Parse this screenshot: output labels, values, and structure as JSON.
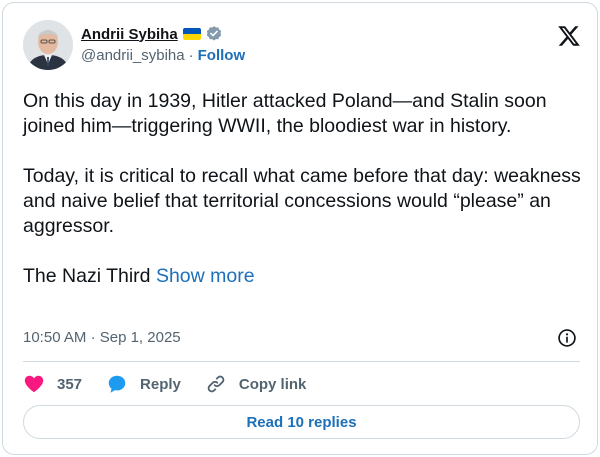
{
  "author": {
    "name": "Andrii Sybiha",
    "handle": "@andrii_sybiha",
    "separator": "·",
    "follow_label": "Follow",
    "flag_icon": "ukraine-flag-icon",
    "verified_icon": "verified-badge-icon"
  },
  "brand_icon": "x-logo-icon",
  "tweet": {
    "text": "On this day in 1939, Hitler attacked Poland—and Stalin soon joined him—triggering WWII, the bloodiest war in history.\n\nToday, it is critical to recall what came before that day: weakness and naive belief that territorial concessions would “please” an aggressor.\n\nThe Nazi Third ",
    "show_more": "Show more"
  },
  "meta": {
    "time": "10:50 AM",
    "separator": "·",
    "date": "Sep 1, 2025",
    "info_icon": "info-icon"
  },
  "actions": {
    "likes": "357",
    "reply_label": "Reply",
    "copy_label": "Copy link"
  },
  "read_replies_label": "Read 10 replies",
  "colors": {
    "link": "#1d6fb8",
    "heart": "#f91880",
    "reply_bubble": "#1d9bf0",
    "border": "#cfd9de",
    "muted": "#536471"
  }
}
